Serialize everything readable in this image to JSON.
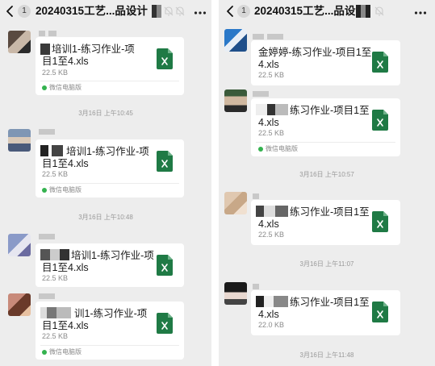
{
  "left": {
    "header": {
      "badge": "1",
      "title": "20240315工艺...品设计"
    },
    "messages": [
      {
        "name": "培训1-练习作业-项目1至4.xls",
        "line1": "培训1-练习作业-项",
        "line2": "目1至4.xls",
        "size": "22.5 KB",
        "source": "微信电脑版"
      },
      {
        "name": "培训1-练习作业-项目1至4.xls",
        "line1": "培训1-练习作业-项",
        "line2": "目1至4.xls",
        "size": "22.5 KB",
        "source": "微信电脑版"
      },
      {
        "name": "培训1-练习作业-项目1至4.xls",
        "line1": "培训1-练习作业-项",
        "line2": "目1至4.xls",
        "size": "22.5 KB"
      },
      {
        "name": "训1-练习作业-项目1至4.xls",
        "line1": "训1-练习作业-项",
        "line2": "目1至4.xls",
        "size": "22.5 KB",
        "source": "微信电脑版"
      }
    ],
    "timestamps": [
      "3月16日 上午10:45",
      "3月16日 上午10:48"
    ]
  },
  "right": {
    "header": {
      "badge": "1",
      "title": "20240315工艺...品设计"
    },
    "messages": [
      {
        "line1": "金婷婷-练习作业-项目1至",
        "line2": "4.xls",
        "size": "22.5 KB"
      },
      {
        "line1": "练习作业-项目1至",
        "line2": "4.xls",
        "size": "22.5 KB",
        "source": "微信电脑版"
      },
      {
        "line1": "练习作业-项目1至",
        "line2": "4.xls",
        "size": "22.5 KB"
      },
      {
        "line1": "练习作业-项目1至",
        "line2": "4.xls",
        "size": "22.0 KB"
      }
    ],
    "timestamps": [
      "3月16日 上午10:57",
      "3月16日 上午11:07",
      "3月16日 上午11:48"
    ]
  },
  "icons": {
    "file": "excel-file-icon",
    "back": "chevron-left-icon",
    "more": "more-dots-icon",
    "mute": "mute-bell-icon",
    "source": "wechat-dot-icon"
  },
  "colors": {
    "excel_green": "#1f7a45",
    "chat_bg": "#ededed",
    "bubble_bg": "#ffffff",
    "source_green": "#34b24f"
  }
}
